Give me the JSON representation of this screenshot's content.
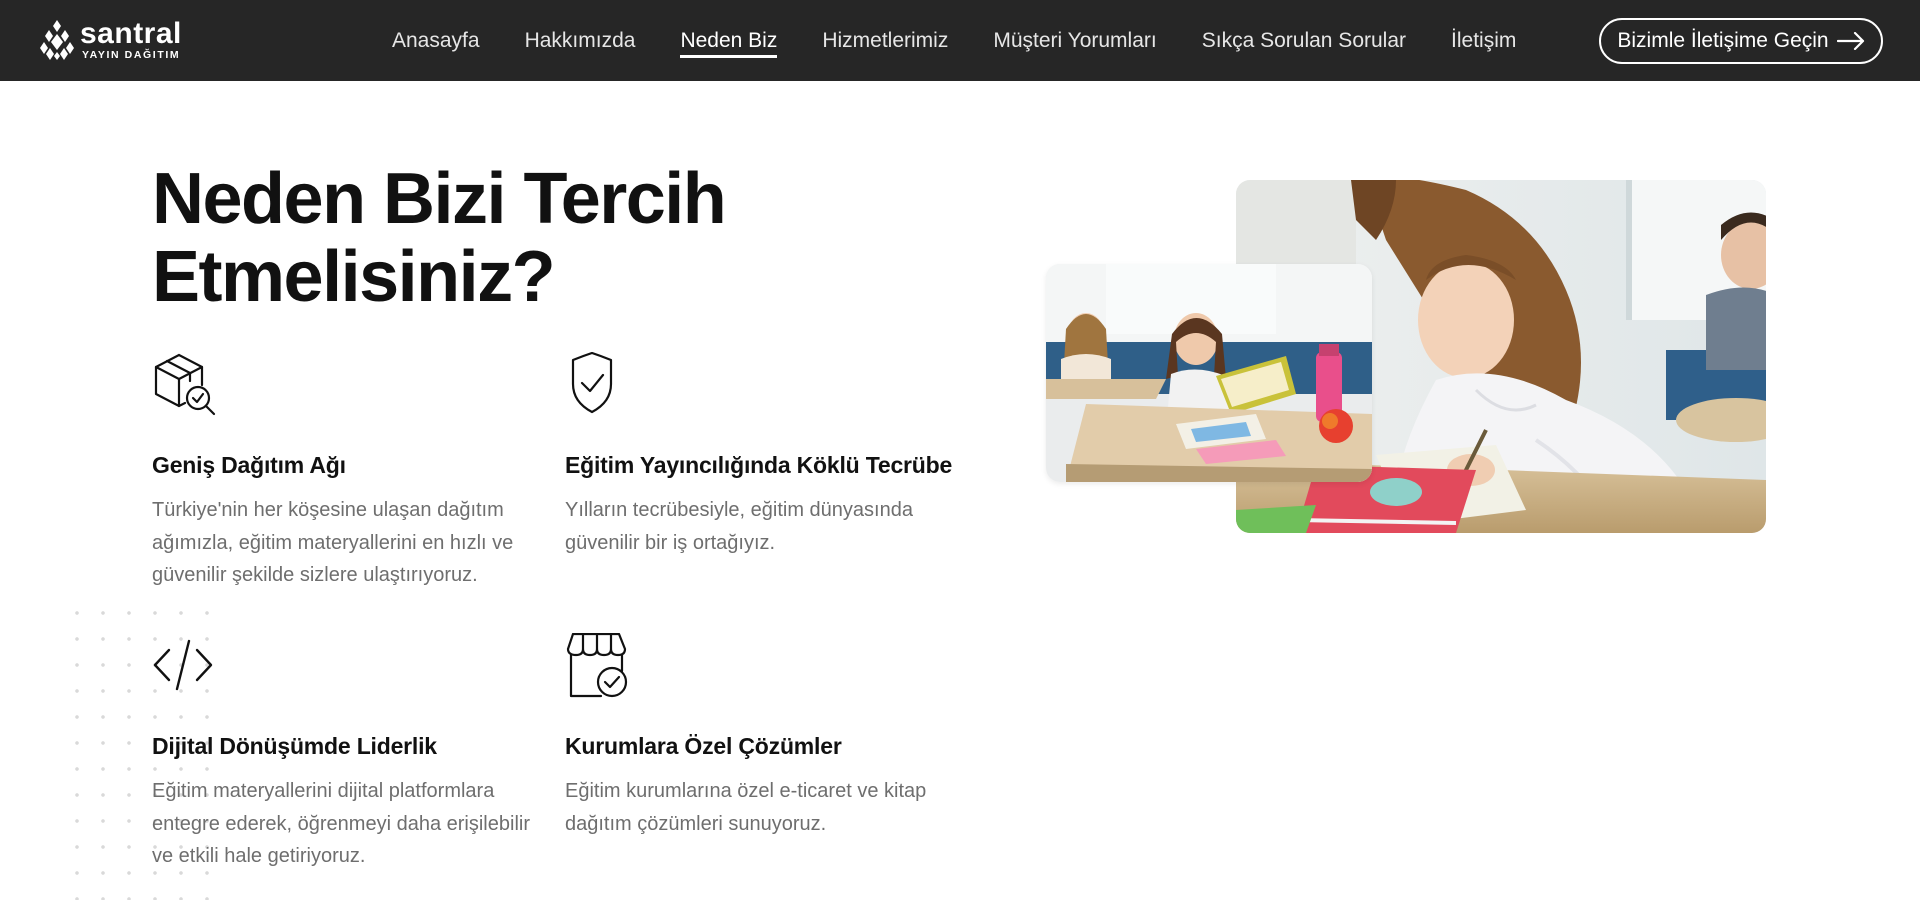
{
  "brand": {
    "name": "santral",
    "subtitle": "YAYIN DAĞITIM"
  },
  "nav": {
    "items": [
      {
        "label": "Anasayfa",
        "active": false
      },
      {
        "label": "Hakkımızda",
        "active": false
      },
      {
        "label": "Neden Biz",
        "active": true
      },
      {
        "label": "Hizmetlerimiz",
        "active": false
      },
      {
        "label": "Müşteri Yorumları",
        "active": false
      },
      {
        "label": "Sıkça Sorulan Sorular",
        "active": false
      },
      {
        "label": "İletişim",
        "active": false
      }
    ],
    "cta_label": "Bizimle İletişime Geçin"
  },
  "main": {
    "title_line1": "Neden Bizi Tercih",
    "title_line2": "Etmelisiniz?",
    "features": [
      {
        "icon": "package-search-icon",
        "title": "Geniş Dağıtım Ağı",
        "desc": "Türkiye'nin her köşesine ulaşan dağıtım ağımızla, eğitim materyallerini en hızlı ve güvenilir şekilde sizlere ulaştırıyoruz."
      },
      {
        "icon": "shield-check-icon",
        "title": "Eğitim Yayıncılığında Köklü Tecrübe",
        "desc": "Yılların tecrübesiyle, eğitim dünyasında güvenilir bir iş ortağıyız."
      },
      {
        "icon": "code-icon",
        "title": "Dijital Dönüşümde Liderlik",
        "desc": "Eğitim materyallerini dijital platformlara entegre ederek, öğrenmeyi daha erişilebilir ve etkili hale getiriyoruz."
      },
      {
        "icon": "store-check-icon",
        "title": "Kurumlara Özel Çözümler",
        "desc": "Eğitim kurumlarına özel e-ticaret ve kitap dağıtım çözümleri sunuyoruz."
      }
    ]
  },
  "colors": {
    "navbar_bg": "#262626",
    "text_dark": "#111111",
    "text_muted": "#6e6e6e",
    "white": "#ffffff"
  }
}
